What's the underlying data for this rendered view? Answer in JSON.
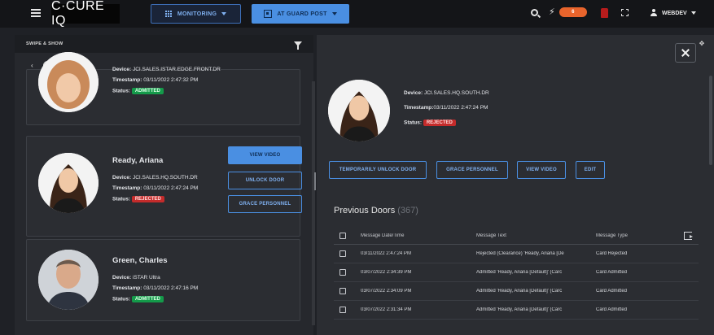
{
  "app": {
    "title": "C·CURE IQ"
  },
  "topbar": {
    "monitoring_label": "MONITORING",
    "guard_label": "AT GUARD POST",
    "alert_count": "6",
    "user_name": "WEBDEV"
  },
  "left_panel": {
    "title": "SWIPE & SHOW",
    "cards": [
      {
        "device_label": "Device:",
        "device": "JCI.SALES.ISTAR.EDGE.FRONT.DR",
        "timestamp_label": "Timestamp:",
        "timestamp": "03/11/2022 2:47:32 PM",
        "status_label": "Status:",
        "status": "ADMITTED"
      },
      {
        "name": "Ready, Ariana",
        "device_label": "Device:",
        "device": "JCI.SALES.HQ.SOUTH.DR",
        "timestamp_label": "Timestamp:",
        "timestamp": "03/11/2022 2:47:24 PM",
        "status_label": "Status:",
        "status": "REJECTED",
        "buttons": [
          "VIEW VIDEO",
          "UNLOCK DOOR",
          "GRACE PERSONNEL"
        ]
      },
      {
        "name": "Green, Charles",
        "device_label": "Device:",
        "device": "iSTAR Ultra",
        "timestamp_label": "Timestamp:",
        "timestamp": "03/11/2022 2:47:16 PM",
        "status_label": "Status:",
        "status": "ADMITTED"
      }
    ]
  },
  "detail": {
    "device_label": "Device:",
    "device": "JCI.SALES.HQ.SOUTH.DR",
    "timestamp_label": "Timestamp:",
    "timestamp": "03/11/2022 2:47:24 PM",
    "status_label": "Status:",
    "status": "REJECTED",
    "actions": [
      "TEMPORARILY UNLOCK DOOR",
      "GRACE PERSONNEL",
      "VIEW VIDEO",
      "EDIT"
    ],
    "previous_title": "Previous Doors",
    "previous_count": "(367)",
    "columns": [
      "Message Date/Time",
      "Message Text",
      "Message Type"
    ],
    "rows": [
      [
        "03/11/2022 2:47:24 PM",
        "Rejected (Clearance) 'Ready, Ariana [De",
        "Card Rejected"
      ],
      [
        "03/07/2022 2:34:39 PM",
        "Admitted 'Ready, Ariana [Default]' (Carc",
        "Card Admitted"
      ],
      [
        "03/07/2022 2:34:09 PM",
        "Admitted 'Ready, Ariana [Default]' (Carc",
        "Card Admitted"
      ],
      [
        "03/07/2022 2:31:34 PM",
        "Admitted 'Ready, Ariana [Default]' (Carc",
        "Card Admitted"
      ]
    ]
  },
  "colors": {
    "accent": "#4a8fe2",
    "admitted": "#149a4a",
    "rejected": "#c42b2b",
    "alert": "#e8642c"
  },
  "icons": [
    "menu-icon",
    "grid-icon",
    "guard-post-icon",
    "search-icon",
    "bolt-icon",
    "bell-icon",
    "expand-icon",
    "user-icon",
    "filter-icon",
    "play-icon",
    "close-icon",
    "export-icon"
  ]
}
